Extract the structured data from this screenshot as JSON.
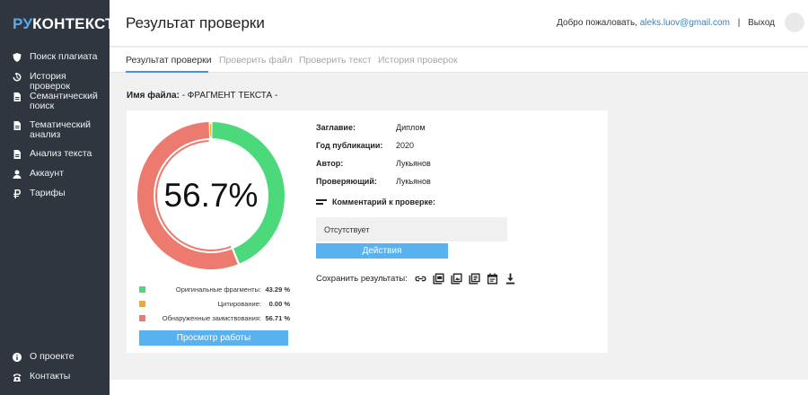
{
  "sidebar": {
    "logo_ru": "РУ",
    "logo_ctx": "КОНТЕКСТ",
    "items": [
      {
        "label": "Поиск плагиата",
        "icon": "shield-icon"
      },
      {
        "label": "История проверок",
        "icon": "history-icon"
      },
      {
        "label": "Семантический поиск",
        "icon": "document-icon"
      },
      {
        "label": "Тематический анализ",
        "icon": "document-icon"
      },
      {
        "label": "Анализ текста",
        "icon": "document-icon"
      },
      {
        "label": "Аккаунт",
        "icon": "user-icon"
      },
      {
        "label": "Тарифы",
        "icon": "ruble-icon"
      }
    ],
    "bottom_items": [
      {
        "label": "О проекте",
        "icon": "info-icon"
      },
      {
        "label": "Контакты",
        "icon": "phone-icon"
      }
    ]
  },
  "header": {
    "title": "Результат проверки",
    "welcome": "Добро пожаловать,",
    "email": "aleks.luov@gmail.com",
    "separator": "|",
    "logout": "Выход"
  },
  "tabs": [
    {
      "label": "Результат проверки",
      "active": true
    },
    {
      "label": "Проверить файл",
      "active": false
    },
    {
      "label": "Проверить текст",
      "active": false
    },
    {
      "label": "История проверок",
      "active": false
    }
  ],
  "file": {
    "label": "Имя файла:",
    "name": "- ФРАГМЕНТ ТЕКСТА -"
  },
  "result": {
    "percent_text": "56.7%",
    "legend": [
      {
        "label": "Оригинальные фрагменты:",
        "value": "43.29 %",
        "fraction": 0.4329,
        "color": "#4cd97b"
      },
      {
        "label": "Цитирование:",
        "value": "0.00 %",
        "fraction": 0.0,
        "color": "#f5a623"
      },
      {
        "label": "Обнаруженные заимствования:",
        "value": "56.71 %",
        "fraction": 0.5671,
        "color": "#ec7a6f"
      }
    ],
    "view_button": "Просмотр работы"
  },
  "meta": [
    {
      "key": "Заглавие:",
      "value": "Диплом"
    },
    {
      "key": "Год публикации:",
      "value": "2020"
    },
    {
      "key": "Автор:",
      "value": "Лукьянов"
    },
    {
      "key": "Проверяющий:",
      "value": "Лукьянов"
    }
  ],
  "comment": {
    "heading": "Комментарий к проверке:",
    "text": "Отсутствует"
  },
  "actions_button": "Действия",
  "save": {
    "label": "Сохранить результаты:",
    "icons": [
      "link-icon",
      "pdf-icon",
      "pdf-icon",
      "book-icon",
      "calendar-icon",
      "download-icon"
    ]
  },
  "colors": {
    "sidebar_bg": "#2f3640",
    "accent": "#58b2ef",
    "original": "#4cd97b",
    "citation": "#f5a623",
    "borrowed": "#ec7a6f"
  }
}
